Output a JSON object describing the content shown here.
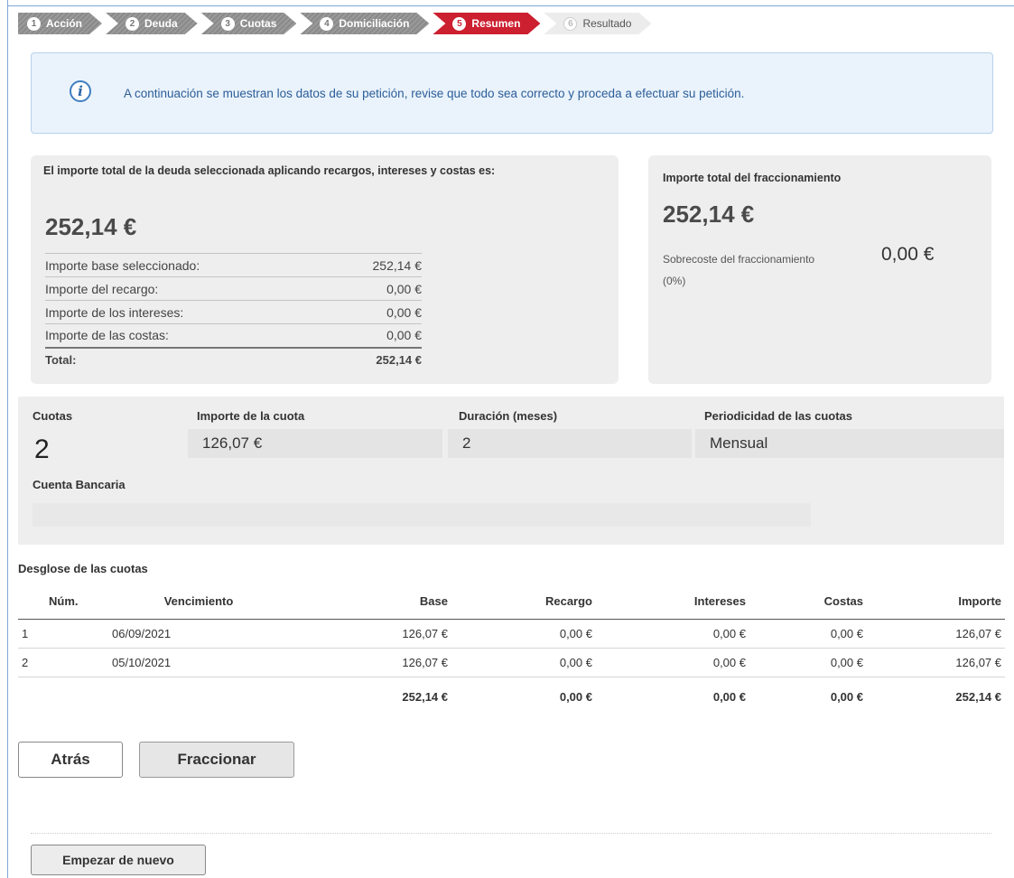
{
  "stepper": {
    "steps": [
      {
        "num": "1",
        "label": "Acción"
      },
      {
        "num": "2",
        "label": "Deuda"
      },
      {
        "num": "3",
        "label": "Cuotas"
      },
      {
        "num": "4",
        "label": "Domiciliación"
      },
      {
        "num": "5",
        "label": "Resumen"
      },
      {
        "num": "6",
        "label": "Resultado"
      }
    ],
    "active_step": "Resumen",
    "active_color": "#cc1f2f"
  },
  "info": {
    "icon": "info-icon",
    "text": "A continuación se muestran los datos de su petición, revise que todo sea correcto y proceda a efectuar su petición."
  },
  "debt": {
    "heading": "El importe total de la deuda seleccionada aplicando recargos, intereses y costas es:",
    "total_amount": "252,14 €",
    "rows": [
      {
        "label": "Importe base seleccionado:",
        "value": "252,14 €"
      },
      {
        "label": "Importe del recargo:",
        "value": "0,00 €"
      },
      {
        "label": "Importe de los intereses:",
        "value": "0,00 €"
      },
      {
        "label": "Importe de las costas:",
        "value": "0,00 €"
      }
    ],
    "total_label": "Total:",
    "total_value": "252,14 €"
  },
  "fraction": {
    "heading": "Importe total del fraccionamiento",
    "total_amount": "252,14 €",
    "surcharge_label": "Sobrecoste del fraccionamiento",
    "surcharge_pct": "(0%)",
    "surcharge_value": "0,00 €"
  },
  "plan": {
    "cuotas_label": "Cuotas",
    "cuotas_value": "2",
    "importe_label": "Importe de la cuota",
    "importe_value": "126,07 €",
    "duracion_label": "Duración (meses)",
    "duracion_value": "2",
    "periodicidad_label": "Periodicidad de las cuotas",
    "periodicidad_value": "Mensual",
    "cuenta_label": "Cuenta Bancaria",
    "cuenta_value": ""
  },
  "breakdown": {
    "title": "Desglose de las cuotas",
    "headers": [
      "Núm.",
      "Vencimiento",
      "Base",
      "Recargo",
      "Intereses",
      "Costas",
      "Importe"
    ],
    "rows": [
      [
        "1",
        "06/09/2021",
        "126,07 €",
        "0,00 €",
        "0,00 €",
        "0,00 €",
        "126,07 €"
      ],
      [
        "2",
        "05/10/2021",
        "126,07 €",
        "0,00 €",
        "0,00 €",
        "0,00 €",
        "126,07 €"
      ]
    ],
    "totals": [
      "",
      "",
      "252,14 €",
      "0,00 €",
      "0,00 €",
      "0,00 €",
      "252,14 €"
    ]
  },
  "buttons": {
    "back": "Atrás",
    "fraccionar": "Fraccionar",
    "restart": "Empezar de nuevo"
  }
}
